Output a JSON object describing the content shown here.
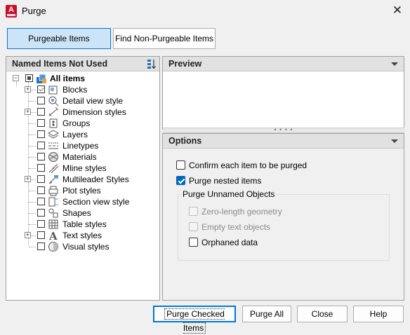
{
  "window": {
    "title": "Purge",
    "close_symbol": "✕",
    "app_icon_letter": "A"
  },
  "tabs": [
    {
      "label": "Purgeable Items",
      "active": true
    },
    {
      "label": "Find Non-Purgeable Items",
      "active": false
    }
  ],
  "left_panel": {
    "header": "Named Items Not Used",
    "tree": {
      "root_label": "All items",
      "items": [
        {
          "label": "Blocks",
          "expandable": true,
          "checked": true,
          "icon": "blocks-icon"
        },
        {
          "label": "Detail view style",
          "expandable": false,
          "checked": false,
          "icon": "detail-view-icon"
        },
        {
          "label": "Dimension styles",
          "expandable": true,
          "checked": false,
          "icon": "dimension-styles-icon"
        },
        {
          "label": "Groups",
          "expandable": false,
          "checked": false,
          "icon": "groups-icon"
        },
        {
          "label": "Layers",
          "expandable": false,
          "checked": false,
          "icon": "layers-icon"
        },
        {
          "label": "Linetypes",
          "expandable": false,
          "checked": false,
          "icon": "linetypes-icon"
        },
        {
          "label": "Materials",
          "expandable": false,
          "checked": false,
          "icon": "materials-icon"
        },
        {
          "label": "Mline styles",
          "expandable": false,
          "checked": false,
          "icon": "mline-styles-icon"
        },
        {
          "label": "Multileader Styles",
          "expandable": true,
          "checked": false,
          "icon": "multileader-styles-icon"
        },
        {
          "label": "Plot styles",
          "expandable": false,
          "checked": false,
          "icon": "plot-styles-icon"
        },
        {
          "label": "Section view style",
          "expandable": false,
          "checked": false,
          "icon": "section-view-icon"
        },
        {
          "label": "Shapes",
          "expandable": false,
          "checked": false,
          "icon": "shapes-icon"
        },
        {
          "label": "Table styles",
          "expandable": false,
          "checked": false,
          "icon": "table-styles-icon"
        },
        {
          "label": "Text styles",
          "expandable": true,
          "checked": false,
          "icon": "text-styles-icon"
        },
        {
          "label": "Visual styles",
          "expandable": false,
          "checked": false,
          "icon": "visual-styles-icon"
        }
      ]
    }
  },
  "preview": {
    "header": "Preview"
  },
  "options": {
    "header": "Options",
    "confirm_label": "Confirm each item to be purged",
    "confirm_checked": false,
    "nested_label": "Purge nested items",
    "nested_checked": true,
    "unnamed_group_label": "Purge Unnamed Objects",
    "zero_length_label": "Zero-length geometry",
    "empty_text_label": "Empty text objects",
    "orphaned_label": "Orphaned data",
    "orphaned_checked": false
  },
  "buttons": {
    "purge_checked": "Purge Checked Items",
    "purge_all": "Purge All",
    "close": "Close",
    "help": "Help"
  },
  "colors": {
    "accent": "#0078d7",
    "active_tab_bg": "#cce4f7",
    "app_icon": "#c8102e"
  }
}
